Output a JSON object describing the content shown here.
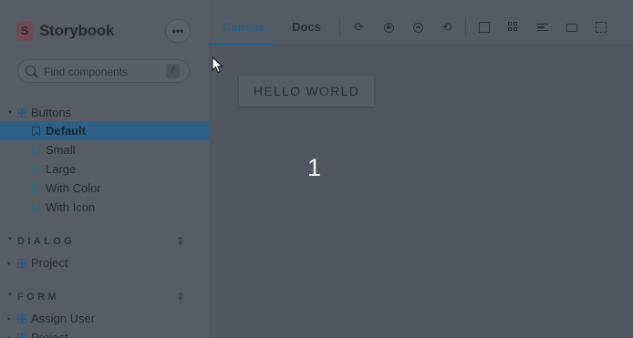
{
  "app": {
    "name": "Storybook"
  },
  "sidebar": {
    "menu_label": "•••",
    "search": {
      "placeholder": "Find components",
      "shortcut": "/"
    },
    "tree": [
      {
        "type": "component",
        "label": "Buttons",
        "expanded": true,
        "stories": [
          "Default",
          "Small",
          "Large",
          "With Color",
          "With Icon"
        ],
        "selected": "Default"
      }
    ],
    "groups": [
      {
        "label": "DIALOG",
        "items": [
          "Project"
        ]
      },
      {
        "label": "FORM",
        "items": [
          "Assign User",
          "Project"
        ]
      }
    ]
  },
  "toolbar": {
    "tabs": [
      "Canvas",
      "Docs"
    ],
    "active_tab": "Canvas",
    "icons": [
      "reload-icon",
      "zoom-in-icon",
      "zoom-out-icon",
      "zoom-reset-icon",
      "background-icon",
      "grid-icon",
      "viewport-icon",
      "measure-icon",
      "outline-icon"
    ]
  },
  "canvas": {
    "button_label": "HELLO WORLD",
    "counter": "1"
  },
  "colors": {
    "accent": "#2a5f88",
    "selected_row": "#2e5f86",
    "overlay_bg": "#505761"
  }
}
